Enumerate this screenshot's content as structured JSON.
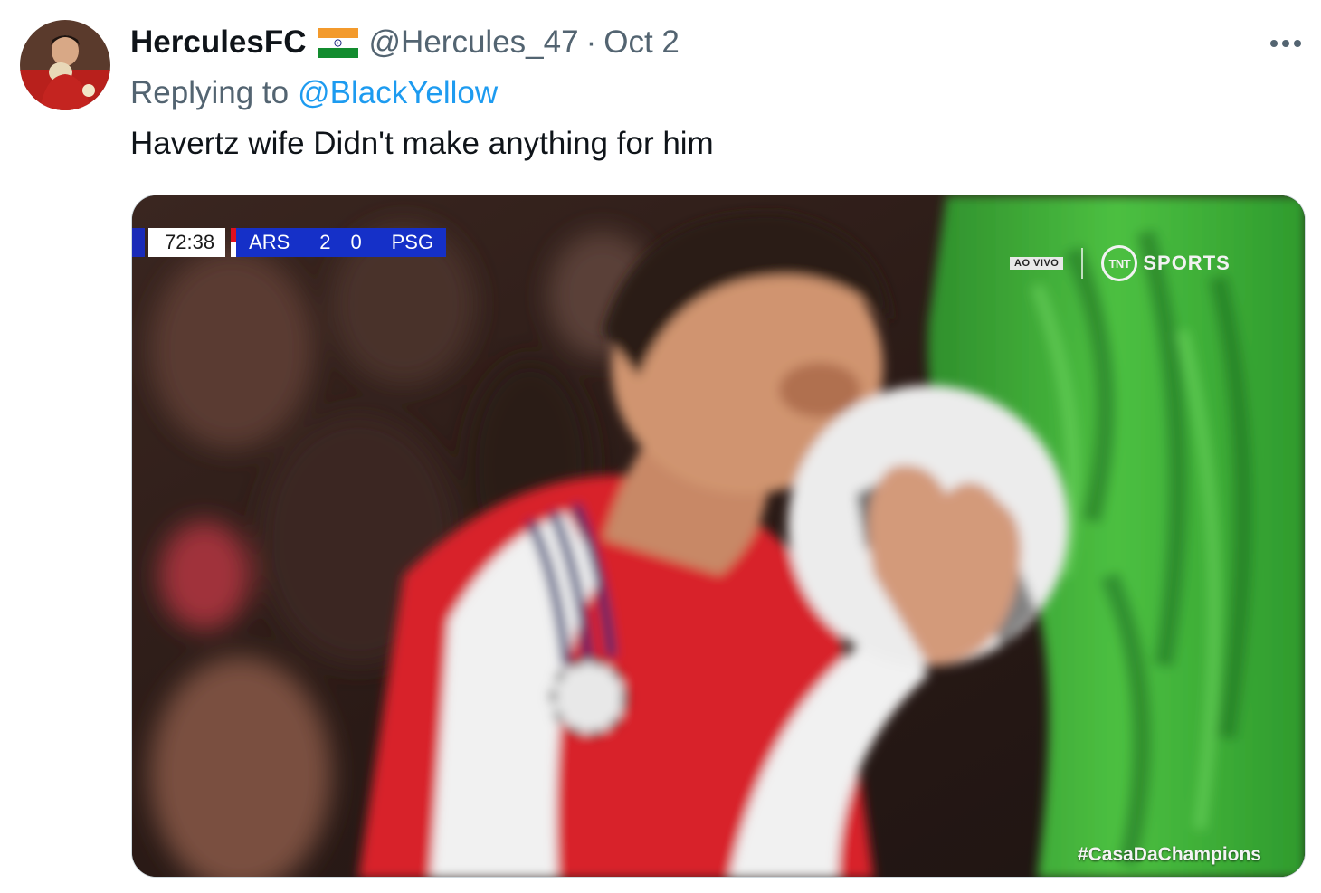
{
  "tweet": {
    "author": {
      "display_name": "HerculesFC",
      "flag_emoji": "🇮🇳",
      "handle": "@Hercules_47",
      "separator": "·",
      "timestamp": "Oct 2",
      "avatar_icon": "avatar-icon"
    },
    "reply": {
      "prefix": "Replying to",
      "mention": "@BlackYellow"
    },
    "text": "Havertz wife Didn't make anything for him",
    "more_icon": "more-icon"
  },
  "media": {
    "scorebug": {
      "clock": "72:38",
      "home_team": "ARS",
      "home_score": "2",
      "away_score": "0",
      "away_team": "PSG"
    },
    "broadcast": {
      "live_label": "AO VIVO",
      "channel_logo": "TNT",
      "channel_label": "SPORTS"
    },
    "hashtag": "#CasaDaChampions"
  },
  "colors": {
    "text_primary": "#0f1419",
    "text_secondary": "#536471",
    "link": "#1d9bf0",
    "scorebug_blue": "#1530c8",
    "arsenal_red": "#d0191f",
    "keeper_green": "#3aa83a"
  }
}
